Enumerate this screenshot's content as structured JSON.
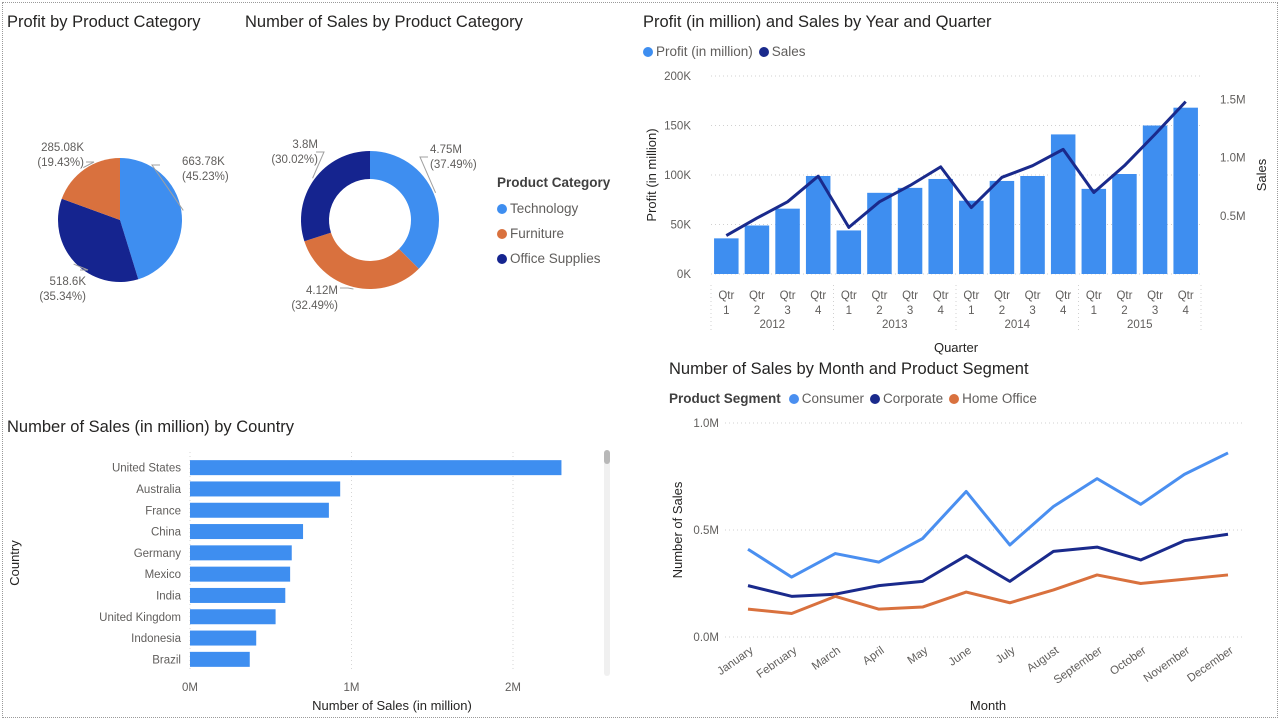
{
  "colors": {
    "technology": "#3e8ef0",
    "furniture": "#d9713e",
    "office_supplies": "#15248f",
    "profit_bar": "#3e8ef0",
    "sales_line": "#1a2a8c",
    "consumer": "#4a8ff0",
    "corporate": "#1a2a8c",
    "home_office": "#d9713e"
  },
  "titles": {
    "pie": "Profit by Product Category",
    "donut": "Number of Sales by Product Category",
    "combo": "Profit (in million) and Sales by Year and Quarter",
    "bar": "Number of Sales (in million) by Country",
    "line": "Number of Sales by Month and Product Segment"
  },
  "category_legend": {
    "title": "Product Category",
    "items": [
      "Technology",
      "Furniture",
      "Office Supplies"
    ]
  },
  "combo_legend": [
    "Profit (in million)",
    "Sales"
  ],
  "segment_legend": {
    "title": "Product Segment",
    "items": [
      "Consumer",
      "Corporate",
      "Home Office"
    ]
  },
  "chart_data": [
    {
      "type": "pie",
      "title": "Profit by Product Category",
      "categories": [
        "Technology",
        "Office Supplies",
        "Furniture"
      ],
      "values": [
        663.78,
        518.6,
        285.08
      ],
      "labels": [
        {
          "value": "663.78K",
          "pct": "(45.23%)"
        },
        {
          "value": "518.6K",
          "pct": "(35.34%)"
        },
        {
          "value": "285.08K",
          "pct": "(19.43%)"
        }
      ]
    },
    {
      "type": "pie",
      "subtype": "donut",
      "title": "Number of Sales by Product Category",
      "categories": [
        "Technology",
        "Furniture",
        "Office Supplies"
      ],
      "values": [
        4.75,
        4.12,
        3.8
      ],
      "labels": [
        {
          "value": "4.75M",
          "pct": "(37.49%)"
        },
        {
          "value": "4.12M",
          "pct": "(32.49%)"
        },
        {
          "value": "3.8M",
          "pct": "(30.02%)"
        }
      ]
    },
    {
      "type": "bar",
      "subtype": "combo-bar-line",
      "title": "Profit (in million) and Sales by Year and Quarter",
      "xlabel": "Quarter",
      "ylabel": "Profit (in million)",
      "y2label": "Sales",
      "years": [
        "2012",
        "2013",
        "2014",
        "2015"
      ],
      "quarters": [
        "Qtr 1",
        "Qtr 2",
        "Qtr 3",
        "Qtr 4"
      ],
      "ylim": [
        0,
        200000
      ],
      "yticks": [
        "0K",
        "50K",
        "100K",
        "150K",
        "200K"
      ],
      "y2lim": [
        0,
        1.7
      ],
      "y2ticks": [
        "0.5M",
        "1.0M",
        "1.5M"
      ],
      "series": [
        {
          "name": "Profit (in million)",
          "kind": "bar",
          "values": [
            36000,
            49000,
            66000,
            99000,
            44000,
            82000,
            87000,
            96000,
            74000,
            94000,
            99000,
            141000,
            86000,
            101000,
            150000,
            168000
          ]
        },
        {
          "name": "Sales",
          "kind": "line",
          "values": [
            0.33,
            0.48,
            0.62,
            0.84,
            0.4,
            0.62,
            0.76,
            0.92,
            0.57,
            0.83,
            0.93,
            1.07,
            0.7,
            0.93,
            1.2,
            1.48
          ]
        }
      ]
    },
    {
      "type": "bar",
      "subtype": "horizontal",
      "title": "Number of Sales (in million) by Country",
      "xlabel": "Number of Sales (in million)",
      "ylabel": "Country",
      "categories": [
        "United States",
        "Australia",
        "France",
        "China",
        "Germany",
        "Mexico",
        "India",
        "United Kingdom",
        "Indonesia",
        "Brazil"
      ],
      "values": [
        2.3,
        0.93,
        0.86,
        0.7,
        0.63,
        0.62,
        0.59,
        0.53,
        0.41,
        0.37
      ],
      "xticks": [
        "0M",
        "1M",
        "2M"
      ],
      "xlim": [
        0,
        2.3
      ]
    },
    {
      "type": "line",
      "title": "Number of Sales by Month and Product Segment",
      "xlabel": "Month",
      "ylabel": "Number of Sales",
      "categories": [
        "January",
        "February",
        "March",
        "April",
        "May",
        "June",
        "July",
        "August",
        "September",
        "October",
        "November",
        "December"
      ],
      "ylim": [
        0,
        1.0
      ],
      "yticks": [
        "0.0M",
        "0.5M",
        "1.0M"
      ],
      "series": [
        {
          "name": "Consumer",
          "values": [
            0.41,
            0.28,
            0.39,
            0.35,
            0.46,
            0.68,
            0.43,
            0.61,
            0.74,
            0.62,
            0.76,
            0.86
          ]
        },
        {
          "name": "Corporate",
          "values": [
            0.24,
            0.19,
            0.2,
            0.24,
            0.26,
            0.38,
            0.26,
            0.4,
            0.42,
            0.36,
            0.45,
            0.48
          ]
        },
        {
          "name": "Home Office",
          "values": [
            0.13,
            0.11,
            0.19,
            0.13,
            0.14,
            0.21,
            0.16,
            0.22,
            0.29,
            0.25,
            0.27,
            0.29
          ]
        }
      ]
    }
  ]
}
